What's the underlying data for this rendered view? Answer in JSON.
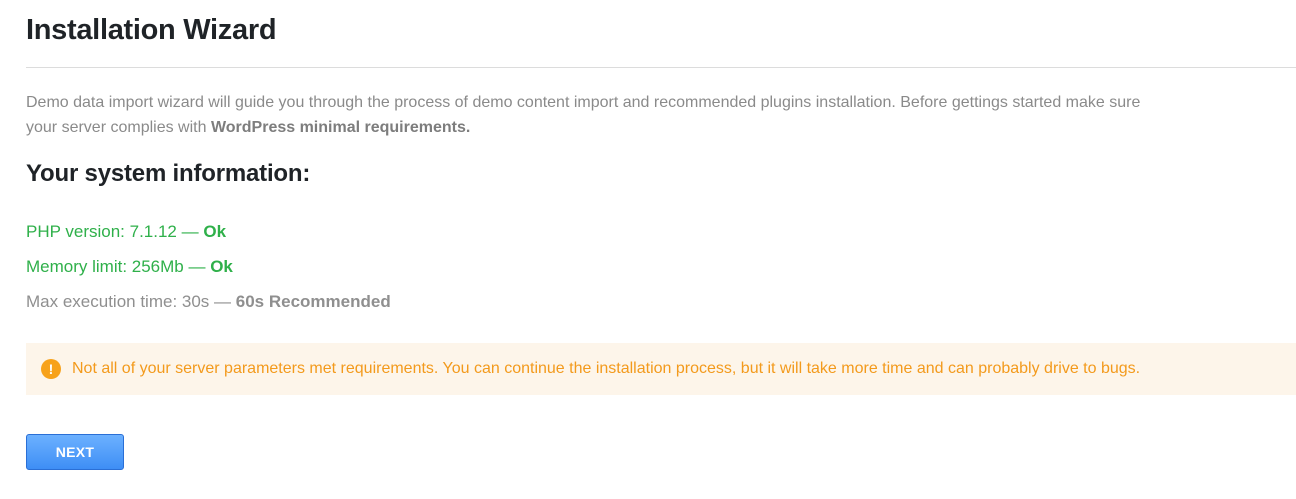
{
  "header": {
    "title": "Installation Wizard"
  },
  "intro": {
    "text_before": "Demo data import wizard will guide you through the process of demo content import and recommended plugins installation. Before gettings started make sure your server complies with ",
    "link_bold": "WordPress minimal requirements."
  },
  "system": {
    "title": "Your system information:",
    "rows": [
      {
        "label": "PHP version: 7.1.12 — ",
        "status": "Ok",
        "state": "ok"
      },
      {
        "label": "Memory limit: 256Mb — ",
        "status": "Ok",
        "state": "ok"
      },
      {
        "label": "Max execution time: 30s — ",
        "status": "60s Recommended",
        "state": "warning"
      }
    ]
  },
  "notice": {
    "icon": "exclamation-circle-icon",
    "icon_glyph": "!",
    "text": "Not all of your server parameters met requirements. You can continue the installation process, but it will take more time and can probably drive to bugs."
  },
  "actions": {
    "next_label": "NEXT"
  },
  "colors": {
    "ok": "#2fb04a",
    "warning": "#f39a1c",
    "notice_bg": "#fdf5ea",
    "button": "#3e8ef5"
  }
}
